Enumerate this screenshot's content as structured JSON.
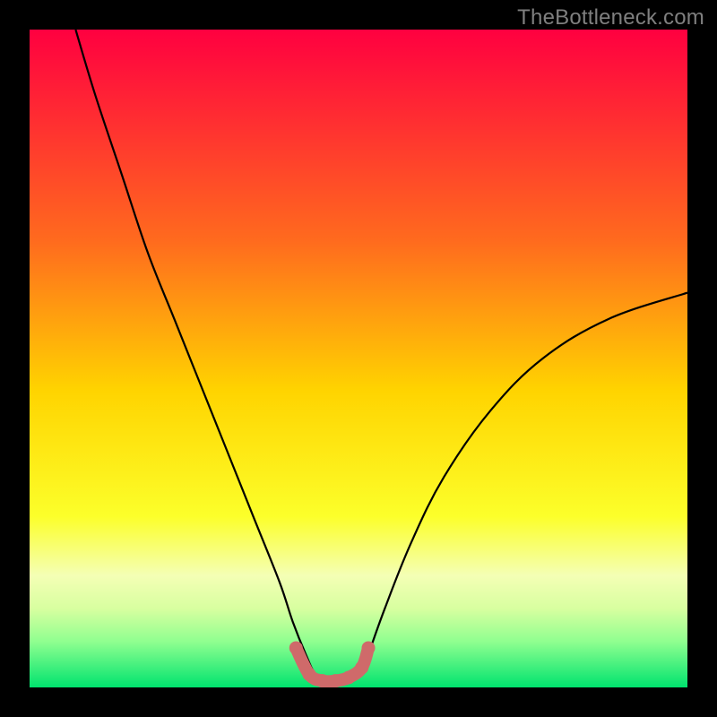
{
  "watermark": "TheBottleneck.com",
  "chart_data": {
    "type": "line",
    "title": "",
    "xlabel": "",
    "ylabel": "",
    "xlim": [
      0,
      100
    ],
    "ylim": [
      0,
      100
    ],
    "grid": false,
    "legend": false,
    "background": {
      "type": "vertical-gradient",
      "stops": [
        {
          "pos": 0,
          "color": "#ff0040"
        },
        {
          "pos": 32,
          "color": "#ff6a1e"
        },
        {
          "pos": 55,
          "color": "#ffd400"
        },
        {
          "pos": 74,
          "color": "#fcff2a"
        },
        {
          "pos": 83,
          "color": "#f4ffb5"
        },
        {
          "pos": 88,
          "color": "#d8ffa0"
        },
        {
          "pos": 93,
          "color": "#90ff90"
        },
        {
          "pos": 100,
          "color": "#00e36e"
        }
      ]
    },
    "series": [
      {
        "name": "bottleneck-curve",
        "color": "#000000",
        "x": [
          7,
          10,
          14,
          18,
          22,
          26,
          30,
          34,
          38,
          40,
          42,
          43.5,
          45.5,
          48,
          50.5,
          51.5,
          54,
          58,
          63,
          70,
          78,
          88,
          100
        ],
        "y": [
          100,
          90,
          78,
          66,
          56,
          46,
          36,
          26,
          16,
          10,
          5,
          2,
          1,
          1,
          2,
          5,
          12,
          22,
          32,
          42,
          50,
          56,
          60
        ]
      },
      {
        "name": "valley-highlight",
        "color": "#cf6a6a",
        "stroke_width": 14,
        "marker": "circle",
        "x": [
          40.5,
          42.5,
          44.5,
          46.5,
          48.5,
          50.5,
          51.5
        ],
        "y": [
          6,
          2,
          1,
          1,
          1.5,
          3,
          6
        ]
      }
    ]
  }
}
